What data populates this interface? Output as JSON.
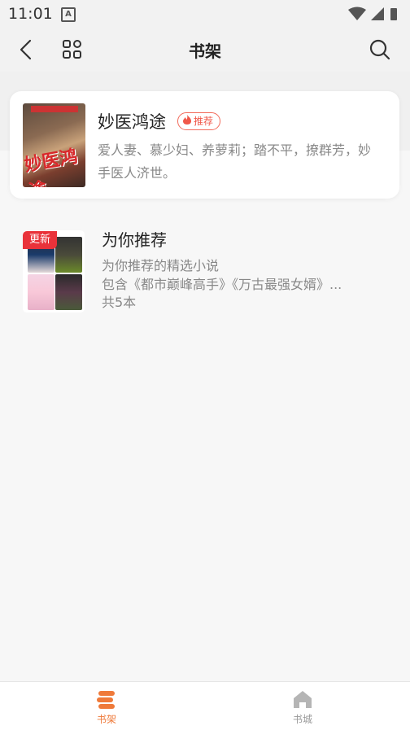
{
  "status_bar": {
    "time": "11:01",
    "notification_icon": "A"
  },
  "header": {
    "title": "书架"
  },
  "featured": {
    "title": "妙医鸿途",
    "badge": "推荐",
    "description": "爱人妻、慕少妇、养萝莉；踏不平，撩群芳，妙手医人济世。",
    "cover_title": "妙医鸿途",
    "accent_color": "#f0584a"
  },
  "recommend": {
    "update_tag": "更新",
    "title": "为你推荐",
    "subtitle": "为你推荐的精选小说",
    "contains": "包含《都市巅峰高手》《万古最强女婿》...",
    "count": "共5本"
  },
  "bottom_nav": {
    "items": [
      {
        "label": "书架",
        "icon": "bookshelf-icon",
        "active": true,
        "color": "#ef7a3a"
      },
      {
        "label": "书城",
        "icon": "home-store-icon",
        "active": false,
        "color": "#999999"
      }
    ]
  }
}
